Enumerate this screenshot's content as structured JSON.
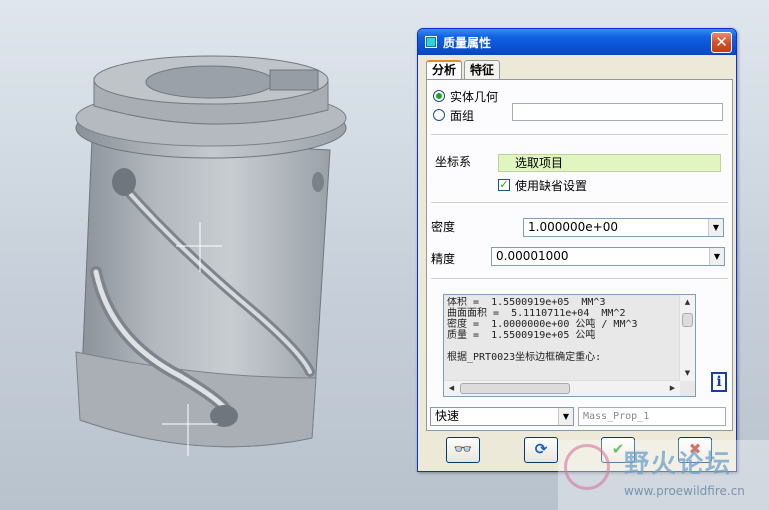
{
  "dialog": {
    "title": "质量属性",
    "close_glyph": "✕",
    "tabs": [
      {
        "label": "分析",
        "active": true
      },
      {
        "label": "特征",
        "active": false
      }
    ],
    "geometry_options": [
      {
        "label": "实体几何",
        "selected": true
      },
      {
        "label": "面组",
        "selected": false
      }
    ],
    "quilt_field_value": "",
    "coordsys_label": "坐标系",
    "coordsys_value": "选取项目",
    "use_default_label": "使用缺省设置",
    "use_default_checked": true,
    "density_label": "密度",
    "density_value": "1.000000e+00",
    "accuracy_label": "精度",
    "accuracy_value": "0.00001000",
    "results_lines": [
      "体积 =  1.5500919e+05  MM^3",
      "曲面面积 =  5.1110711e+04  MM^2",
      "密度 =  1.0000000e+00 公吨 / MM^3",
      "质量 =  1.5500919e+05 公吨",
      "",
      "根据_PRT0023坐标边框确定重心:"
    ],
    "mode_value": "快速",
    "analysis_name": "Mass_Prop_1",
    "info_glyph": "i",
    "buttons": {
      "preview_glyph": "👓",
      "repeat_glyph": "⟳",
      "ok_glyph": "✔",
      "cancel_glyph": "✖"
    },
    "colors": {
      "title_bar": "#0a52d4",
      "select_field": "#e0f5c0",
      "ok_green": "#21a121",
      "cancel_red": "#c0281a"
    }
  },
  "watermark": {
    "title": "野火论坛",
    "url": "www.proewildfire.cn"
  }
}
